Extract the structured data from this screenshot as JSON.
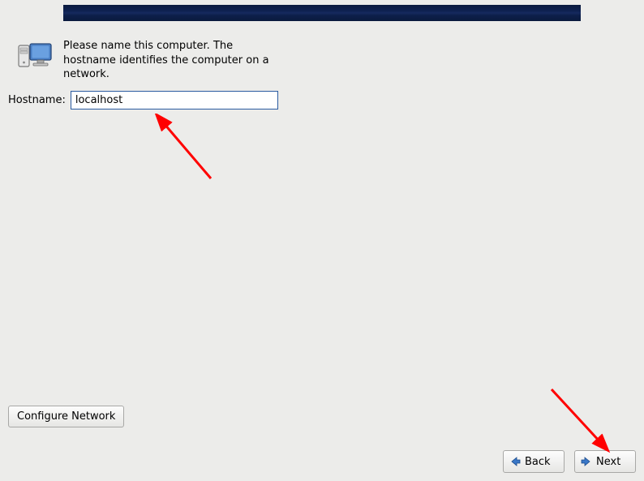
{
  "info": {
    "text": "Please name this computer.  The hostname identifies the computer on a network."
  },
  "hostname": {
    "label": "Hostname:",
    "value": "localhost"
  },
  "buttons": {
    "configure_network": "Configure Network",
    "back": "Back",
    "next": "Next"
  }
}
